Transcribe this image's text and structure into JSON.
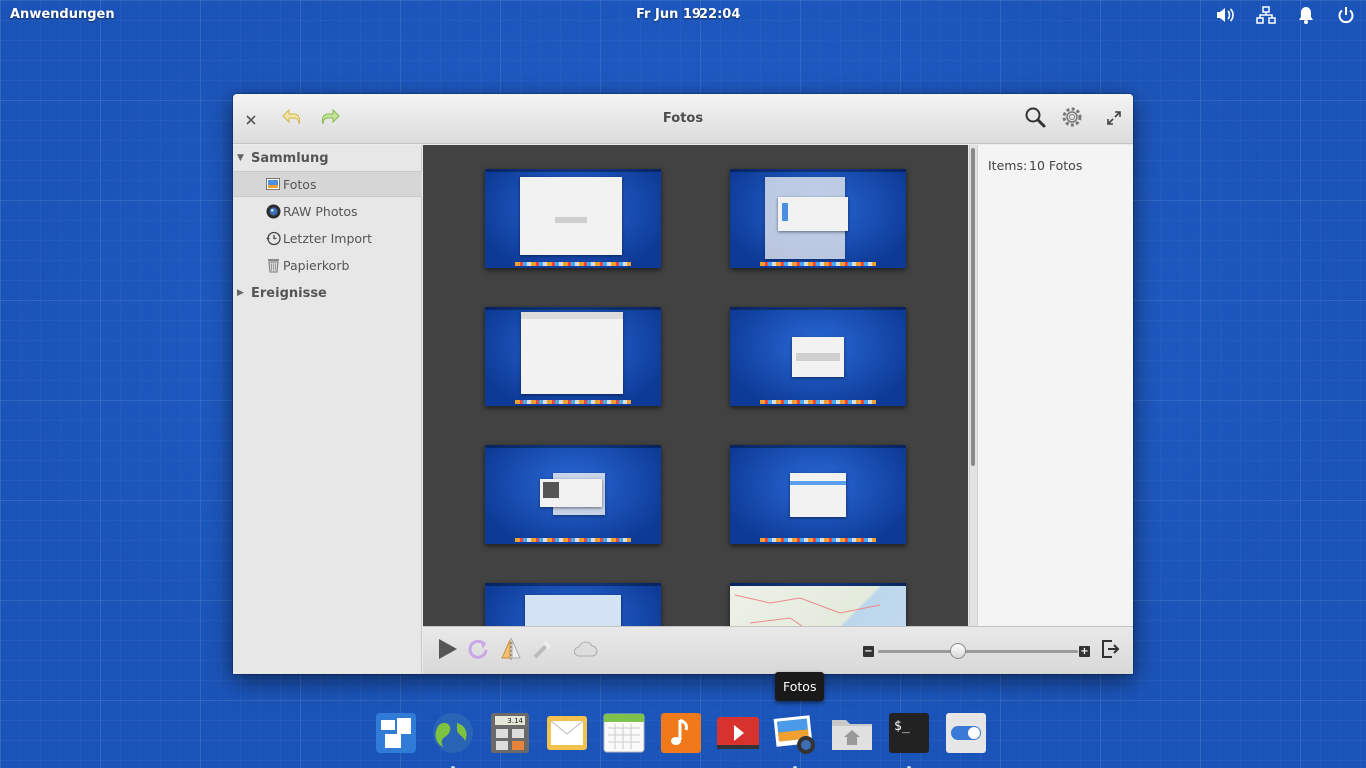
{
  "panel": {
    "apps_label": "Anwendungen",
    "date": "Fr Jun 19",
    "time": "22:04",
    "indicators": [
      "volume-icon",
      "network-icon",
      "notification-icon",
      "power-icon"
    ]
  },
  "window": {
    "title": "Fotos",
    "header_buttons": [
      "close-icon",
      "undo-icon",
      "redo-icon",
      "search-icon",
      "gear-icon",
      "fullscreen-icon"
    ]
  },
  "sidebar": {
    "sections": [
      {
        "label": "Sammlung",
        "expanded": true,
        "items": [
          {
            "label": "Fotos",
            "icon": "photos-icon",
            "selected": true
          },
          {
            "label": "RAW Photos",
            "icon": "camera-icon",
            "selected": false
          },
          {
            "label": "Letzter Import",
            "icon": "history-icon",
            "selected": false
          },
          {
            "label": "Papierkorb",
            "icon": "trash-icon",
            "selected": false
          }
        ]
      },
      {
        "label": "Ereignisse",
        "expanded": false,
        "items": []
      }
    ]
  },
  "info": {
    "items_label": "Items:",
    "items_value": "10 Fotos"
  },
  "thumbnails": [
    {
      "kind": "desktop-dialog"
    },
    {
      "kind": "desktop-about"
    },
    {
      "kind": "desktop-editor"
    },
    {
      "kind": "desktop-small-dialog"
    },
    {
      "kind": "desktop-stacked"
    },
    {
      "kind": "desktop-settings"
    },
    {
      "kind": "desktop-window"
    },
    {
      "kind": "map"
    }
  ],
  "toolbar": {
    "tools": [
      "play-icon",
      "rotate-icon",
      "flip-icon",
      "enhance-icon",
      "publish-icon"
    ],
    "zoom_minus": "−",
    "zoom_plus": "+",
    "zoom_level": 0.4
  },
  "tooltip": {
    "text": "Fotos"
  },
  "dock": {
    "apps": [
      {
        "name": "multitasking-view",
        "running": false
      },
      {
        "name": "web-browser",
        "running": true
      },
      {
        "name": "calculator",
        "running": false,
        "display": "3.14"
      },
      {
        "name": "mail",
        "running": false
      },
      {
        "name": "calendar",
        "running": false
      },
      {
        "name": "music",
        "running": false
      },
      {
        "name": "videos",
        "running": false
      },
      {
        "name": "photos",
        "running": true
      },
      {
        "name": "files",
        "running": false
      },
      {
        "name": "terminal",
        "running": true
      },
      {
        "name": "system-settings",
        "running": false
      }
    ]
  },
  "colors": {
    "desktop": "#1b54b8",
    "viewer_bg": "#424242",
    "sidebar_bg": "#e7e7e7"
  }
}
